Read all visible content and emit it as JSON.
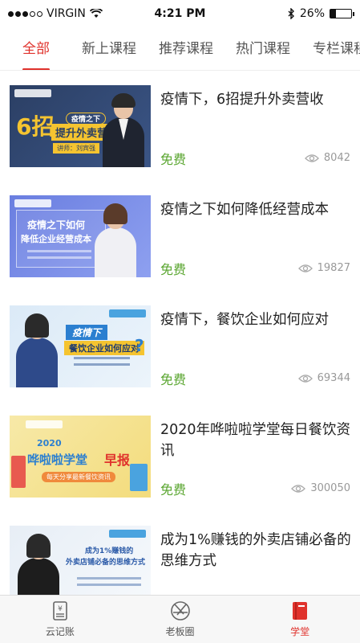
{
  "status_bar": {
    "carrier": "VIRGIN",
    "time": "4:21 PM",
    "battery": "26%",
    "battery_level": 0.26
  },
  "tabs": [
    {
      "label": "全部",
      "active": true
    },
    {
      "label": "新上课程",
      "active": false
    },
    {
      "label": "推荐课程",
      "active": false
    },
    {
      "label": "热门课程",
      "active": false
    },
    {
      "label": "专栏课程",
      "active": false
    }
  ],
  "courses": [
    {
      "title": "疫情下，6招提升外卖营收",
      "price": "免费",
      "views": "8042",
      "thumb_text": {
        "big": "6招",
        "tag": "疫情之下",
        "main": "提升外卖营收",
        "sub": "讲师：刘宾强"
      }
    },
    {
      "title": "疫情之下如何降低经营成本",
      "price": "免费",
      "views": "19827",
      "thumb_text": {
        "line1": "疫情之下如何",
        "line2": "降低企业经营成本"
      }
    },
    {
      "title": "疫情下，餐饮企业如何应对",
      "price": "免费",
      "views": "69344",
      "thumb_text": {
        "line1": "疫情下",
        "line2": "餐饮企业如何应对"
      }
    },
    {
      "title": "2020年哗啦啦学堂每日餐饮资讯",
      "price": "免费",
      "views": "300050",
      "thumb_text": {
        "year": "2020",
        "main": "哗啦啦学堂",
        "accent": "早报",
        "sub": "每天分享最新餐饮资讯"
      }
    },
    {
      "title": "成为1%赚钱的外卖店铺必备的思维方式",
      "price": "",
      "views": "",
      "thumb_text": {
        "line1": "成为1%赚钱的",
        "line2": "外卖店铺必备的思维方式"
      }
    }
  ],
  "bottom_nav": [
    {
      "label": "云记账",
      "icon": "ledger-icon",
      "active": false
    },
    {
      "label": "老板圈",
      "icon": "aperture-icon",
      "active": false
    },
    {
      "label": "学堂",
      "icon": "book-icon",
      "active": true
    }
  ],
  "colors": {
    "accent": "#e0322c",
    "free": "#5aa630",
    "muted": "#999999"
  }
}
